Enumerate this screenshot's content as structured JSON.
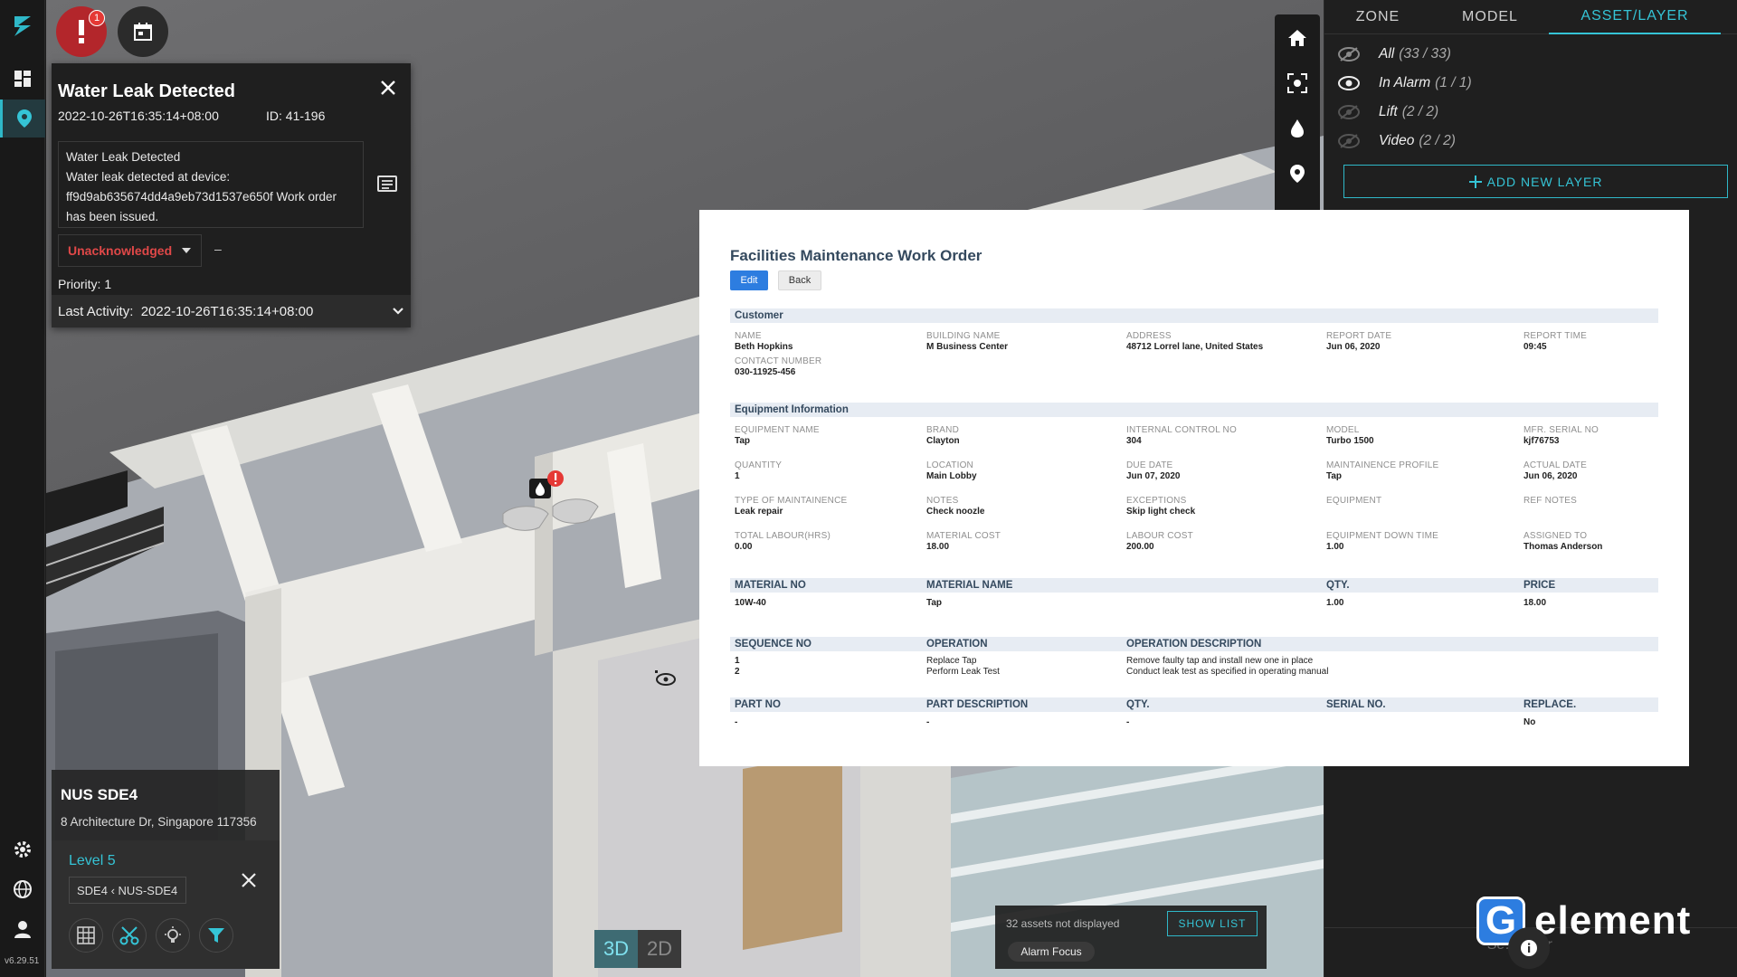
{
  "app": {
    "version": "v6.29.51"
  },
  "alarm_button": {
    "badge": "1"
  },
  "alarm": {
    "title": "Water Leak Detected",
    "timestamp": "2022-10-26T16:35:14+08:00",
    "id_label": "ID: 41-196",
    "message_title": "Water Leak Detected",
    "message_line1": "Water leak detected at device:",
    "message_line2": "ff9d9ab635674dd4a9eb73d1537e650f Work order",
    "message_line3": "has been issued.",
    "status": "Unacknowledged",
    "assignee": "–",
    "priority": "Priority: 1",
    "last_activity_label": "Last Activity:",
    "last_activity_time": "2022-10-26T16:35:14+08:00"
  },
  "right_panel": {
    "tabs": [
      "ZONE",
      "MODEL",
      "ASSET/LAYER"
    ],
    "active_tab": "ASSET/LAYER",
    "layers": [
      {
        "name": "All",
        "count": "(33 / 33)",
        "visible": true
      },
      {
        "name": "In Alarm",
        "count": "(1 / 1)",
        "visible": true
      },
      {
        "name": "Lift",
        "count": "(2 / 2)",
        "visible": false
      },
      {
        "name": "Video",
        "count": "(2 / 2)",
        "visible": false
      }
    ],
    "add_layer_label": "ADD NEW LAYER",
    "search_placeholder": "Se…   ayer"
  },
  "work_order": {
    "title": "Facilities Maintenance Work Order",
    "edit_label": "Edit",
    "back_label": "Back",
    "customer_section": "Customer",
    "customer": {
      "name_label": "NAME",
      "name": "Beth Hopkins",
      "building_label": "BUILDING NAME",
      "building": "M Business Center",
      "address_label": "ADDRESS",
      "address": "48712 Lorrel lane, United States",
      "report_date_label": "REPORT DATE",
      "report_date": "Jun 06, 2020",
      "report_time_label": "REPORT TIME",
      "report_time": "09:45",
      "contact_label": "CONTACT NUMBER",
      "contact": "030-11925-456"
    },
    "equipment_section": "Equipment Information",
    "equipment": {
      "eq_name_label": "EQUIPMENT NAME",
      "eq_name": "Tap",
      "brand_label": "BRAND",
      "brand": "Clayton",
      "icn_label": "INTERNAL CONTROL NO",
      "icn": "304",
      "model_label": "MODEL",
      "model": "Turbo 1500",
      "serial_label": "MFR. SERIAL NO",
      "serial": "kjf76753",
      "qty_label": "QUANTITY",
      "qty": "1",
      "location_label": "LOCATION",
      "location": "Main Lobby",
      "due_label": "DUE DATE",
      "due": "Jun 07, 2020",
      "profile_label": "MAINTAINENCE PROFILE",
      "profile": "Tap",
      "actual_label": "ACTUAL DATE",
      "actual": "Jun 06, 2020",
      "type_label": "TYPE OF MAINTAINENCE",
      "type": "Leak repair",
      "notes_label": "NOTES",
      "notes": "Check noozle",
      "exceptions_label": "EXCEPTIONS",
      "exceptions": "Skip light check",
      "equipment_label": "EQUIPMENT",
      "ref_notes_label": "REF NOTES",
      "labour_hrs_label": "TOTAL LABOUR(HRS)",
      "labour_hrs": "0.00",
      "material_cost_label": "MATERIAL COST",
      "material_cost": "18.00",
      "labour_cost_label": "LABOUR COST",
      "labour_cost": "200.00",
      "downtime_label": "EQUIPMENT DOWN TIME",
      "downtime": "1.00",
      "assigned_label": "ASSIGNED TO",
      "assigned": "Thomas Anderson"
    },
    "materials": {
      "headers": [
        "MATERIAL NO",
        "MATERIAL NAME",
        "QTY.",
        "PRICE"
      ],
      "row": [
        "10W-40",
        "Tap",
        "1.00",
        "18.00"
      ]
    },
    "operations": {
      "headers": [
        "SEQUENCE NO",
        "OPERATION",
        "OPERATION DESCRIPTION"
      ],
      "rows": [
        [
          "1",
          "Replace Tap",
          "Remove faulty tap and install new one in place"
        ],
        [
          "2",
          "Perform Leak Test",
          "Conduct leak test as specified in operating manual"
        ]
      ]
    },
    "parts": {
      "headers": [
        "PART NO",
        "PART DESCRIPTION",
        "QTY.",
        "SERIAL NO.",
        "REPLACE."
      ],
      "row": [
        "-",
        "-",
        "-",
        "",
        "No"
      ]
    }
  },
  "location_card": {
    "name": "NUS SDE4",
    "address": "8 Architecture Dr, Singapore 117356",
    "level": "Level 5",
    "building_path": "SDE4 ‹ NUS-SDE4"
  },
  "view_toggle": {
    "three_d": "3D",
    "two_d": "2D",
    "active": "3D"
  },
  "assets_bar": {
    "not_displayed": "32 assets not displayed",
    "show_list": "SHOW LIST",
    "alarm_focus": "Alarm Focus"
  },
  "brand": {
    "letter": "G",
    "word": "element"
  },
  "colors": {
    "accent": "#35c4d6",
    "alarm": "#b3262b",
    "status_red": "#e04848",
    "primary_blue": "#2d7de0"
  }
}
